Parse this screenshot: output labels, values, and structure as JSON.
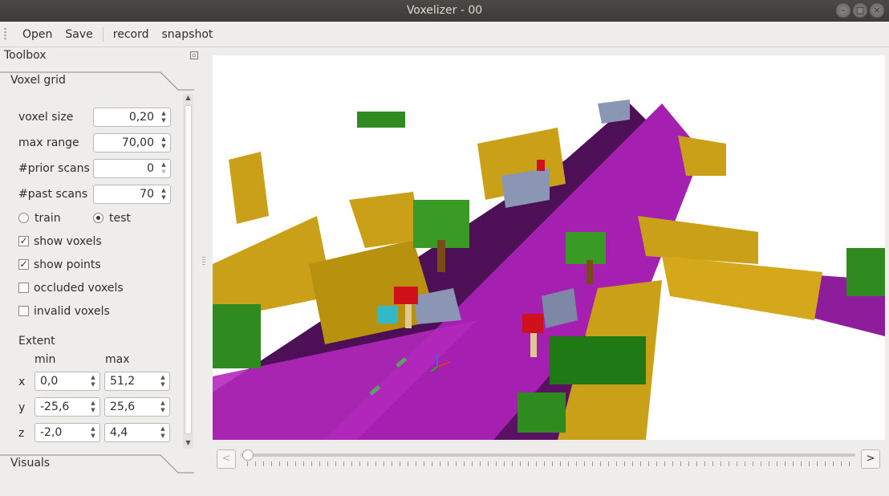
{
  "window": {
    "title": "Voxelizer - 00"
  },
  "menu": {
    "open": "Open",
    "save": "Save",
    "record": "record",
    "snapshot": "snapshot"
  },
  "toolbox": {
    "title": "Toolbox",
    "tab_voxel_grid": "Voxel grid",
    "tab_visuals": "Visuals",
    "voxel_size": {
      "label": "voxel size",
      "value": "0,20"
    },
    "max_range": {
      "label": "max range",
      "value": "70,00"
    },
    "prior_scans": {
      "label": "#prior scans",
      "value": "0"
    },
    "past_scans": {
      "label": "#past scans",
      "value": "70"
    },
    "mode": {
      "train": "train",
      "test": "test",
      "selected": "test"
    },
    "show_voxels": {
      "label": "show voxels",
      "checked": true,
      "mark": "✓"
    },
    "show_points": {
      "label": "show points",
      "checked": true,
      "mark": "✓"
    },
    "occluded_voxels": {
      "label": "occluded voxels",
      "checked": false
    },
    "invalid_voxels": {
      "label": "invalid voxels",
      "checked": false
    },
    "extent": {
      "title": "Extent",
      "min_label": "min",
      "max_label": "max",
      "x": {
        "label": "x",
        "min": "0,0",
        "max": "51,2"
      },
      "y": {
        "label": "y",
        "min": "-25,6",
        "max": "25,6"
      },
      "z": {
        "label": "z",
        "min": "-2,0",
        "max": "4,4"
      }
    }
  },
  "navigation": {
    "prev": "<",
    "next": ">",
    "slider_position": 0
  },
  "colors": {
    "road": "#a51fb0",
    "sidewalk": "#5a1060",
    "building": "#c9a018",
    "vegetation": "#2f8a1f",
    "car": "#8a96b4",
    "trunk": "#7a4a18",
    "person": "#d0101a",
    "truck": "#34b8c8"
  }
}
